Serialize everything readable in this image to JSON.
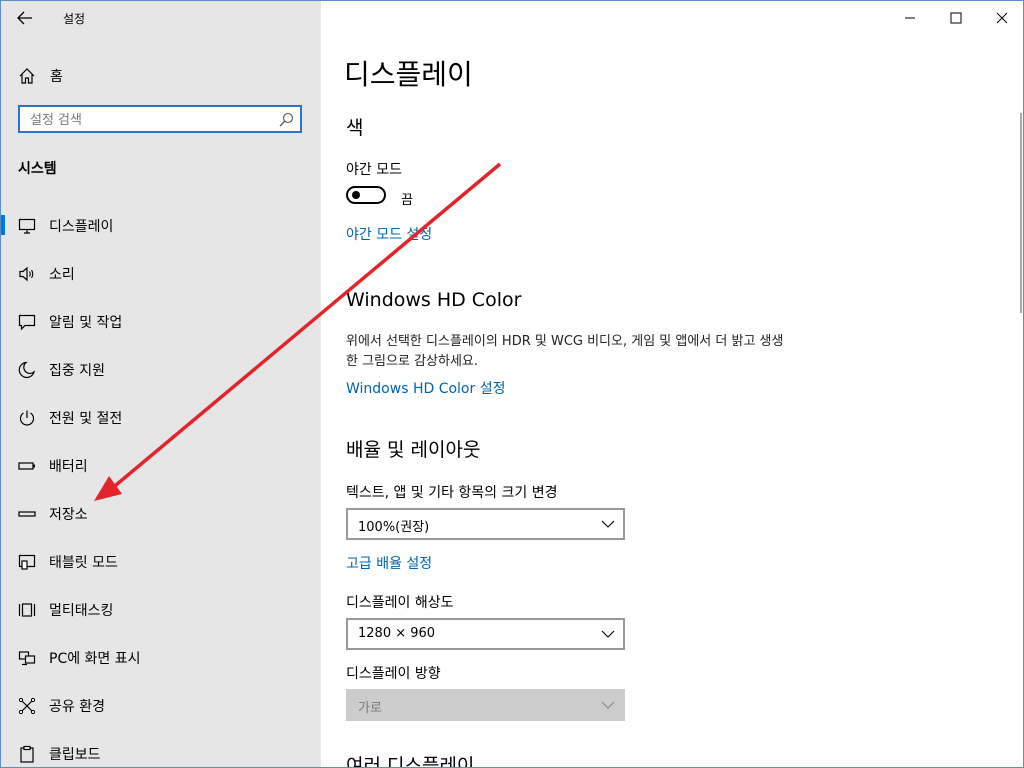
{
  "window": {
    "title": "설정",
    "minimize_label": "최소화",
    "maximize_label": "최대화",
    "close_label": "닫기"
  },
  "sidebar": {
    "home_label": "홈",
    "search_placeholder": "설정 검색",
    "section_title": "시스템",
    "selected_index": 0,
    "items": [
      {
        "label": "디스플레이",
        "icon": "monitor-icon"
      },
      {
        "label": "소리",
        "icon": "speaker-icon"
      },
      {
        "label": "알림 및 작업",
        "icon": "notification-icon"
      },
      {
        "label": "집중 지원",
        "icon": "moon-icon"
      },
      {
        "label": "전원 및 절전",
        "icon": "power-icon"
      },
      {
        "label": "배터리",
        "icon": "battery-icon"
      },
      {
        "label": "저장소",
        "icon": "storage-icon"
      },
      {
        "label": "태블릿 모드",
        "icon": "tablet-icon"
      },
      {
        "label": "멀티태스킹",
        "icon": "multitasking-icon"
      },
      {
        "label": "PC에 화면 표시",
        "icon": "project-icon"
      },
      {
        "label": "공유 환경",
        "icon": "shared-experiences-icon"
      },
      {
        "label": "클립보드",
        "icon": "clipboard-icon"
      }
    ]
  },
  "main": {
    "title": "디스플레이",
    "color_section": {
      "heading": "색",
      "night_light_label": "야간 모드",
      "night_light_state": "끔",
      "night_light_on": false,
      "night_light_settings_link": "야간 모드 설정"
    },
    "hdr_section": {
      "heading": "Windows HD Color",
      "description": "위에서 선택한 디스플레이의 HDR 및 WCG 비디오, 게임 및 앱에서 더 밝고 생생한 그림으로 감상하세요.",
      "link": "Windows HD Color 설정"
    },
    "scale_section": {
      "heading": "배율 및 레이아웃",
      "scale_label": "텍스트, 앱 및 기타 항목의 크기 변경",
      "scale_value": "100%(권장)",
      "advanced_scaling_link": "고급 배율 설정",
      "resolution_label": "디스플레이 해상도",
      "resolution_value": "1280 × 960",
      "orientation_label": "디스플레이 방향",
      "orientation_value": "가로"
    },
    "multi_display_heading": "여러 디스플레이"
  },
  "colors": {
    "accent": "#0078d7",
    "link": "#0063b1",
    "sidebar_bg": "#e6e6e6",
    "annotation_arrow": "#e3242b"
  }
}
